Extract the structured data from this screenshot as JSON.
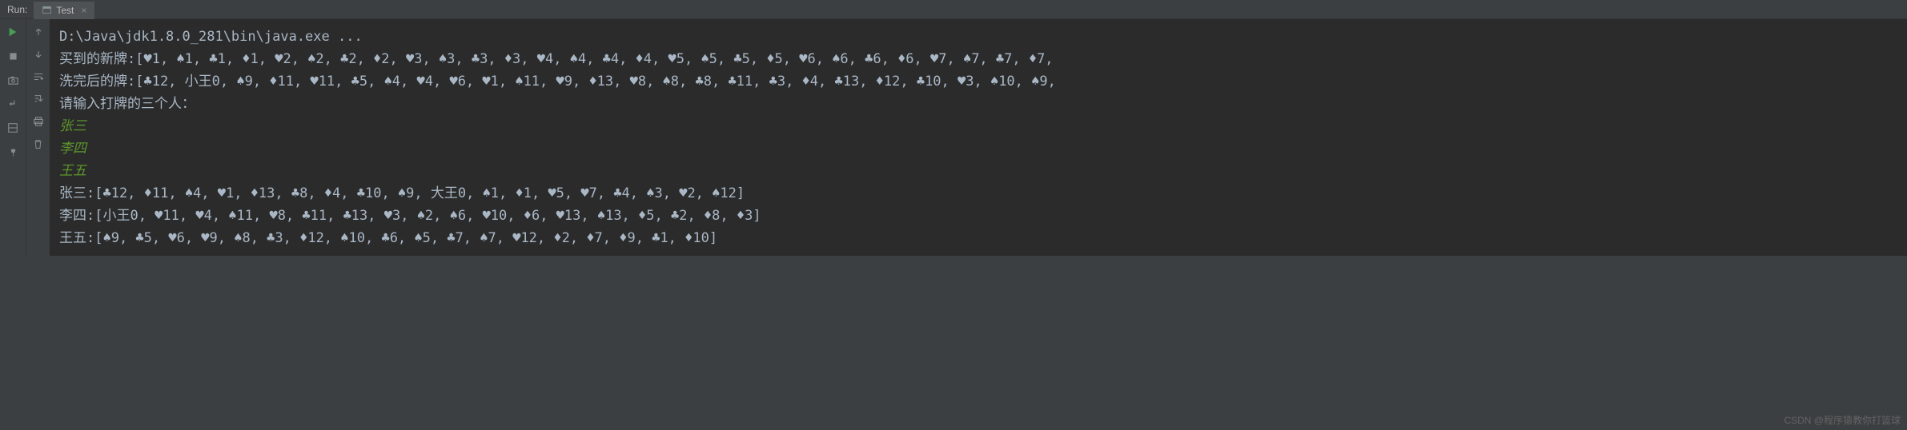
{
  "header": {
    "run_label": "Run:",
    "tab_name": "Test"
  },
  "console": {
    "lines": [
      {
        "text": "D:\\Java\\jdk1.8.0_281\\bin\\java.exe ...",
        "type": "normal"
      },
      {
        "text": "买到的新牌:[♥1, ♠1, ♣1, ♦1, ♥2, ♠2, ♣2, ♦2, ♥3, ♠3, ♣3, ♦3, ♥4, ♠4, ♣4, ♦4, ♥5, ♠5, ♣5, ♦5, ♥6, ♠6, ♣6, ♦6, ♥7, ♠7, ♣7, ♦7,",
        "type": "normal"
      },
      {
        "text": "洗完后的牌:[♣12, 小王0, ♠9, ♦11, ♥11, ♣5, ♠4, ♥4, ♥6, ♥1, ♠11, ♥9, ♦13, ♥8, ♠8, ♣8, ♣11, ♣3, ♦4, ♣13, ♦12, ♣10, ♥3, ♠10, ♠9,",
        "type": "normal"
      },
      {
        "text": "请输入打牌的三个人：",
        "type": "normal"
      },
      {
        "text": "张三",
        "type": "input"
      },
      {
        "text": "李四",
        "type": "input"
      },
      {
        "text": "王五",
        "type": "input"
      },
      {
        "text": "张三:[♣12, ♦11, ♠4, ♥1, ♦13, ♣8, ♦4, ♣10, ♠9, 大王0, ♠1, ♦1, ♥5, ♥7, ♣4, ♠3, ♥2, ♠12]",
        "type": "normal"
      },
      {
        "text": "李四:[小王0, ♥11, ♥4, ♠11, ♥8, ♣11, ♣13, ♥3, ♠2, ♠6, ♥10, ♦6, ♥13, ♠13, ♦5, ♣2, ♦8, ♦3]",
        "type": "normal"
      },
      {
        "text": "王五:[♠9, ♣5, ♥6, ♥9, ♠8, ♣3, ♦12, ♠10, ♣6, ♠5, ♣7, ♠7, ♥12, ♦2, ♦7, ♦9, ♣1, ♦10]",
        "type": "normal"
      }
    ]
  },
  "watermark": "CSDN @程序猿教你打篮球"
}
